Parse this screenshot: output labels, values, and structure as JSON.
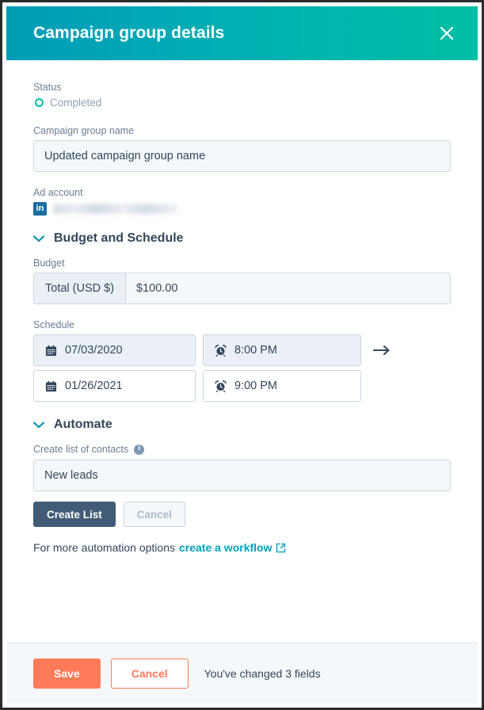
{
  "header": {
    "title": "Campaign group details",
    "close_label": "Close",
    "gradient_start": "#009cb7",
    "gradient_end": "#00bfa5"
  },
  "status": {
    "label": "Status",
    "value": "Completed",
    "indicator_color": "#00bda5"
  },
  "campaign_group_name": {
    "label": "Campaign group name",
    "value": "Updated campaign group name"
  },
  "ad_account": {
    "label": "Ad account",
    "network_icon": "linkedin-icon",
    "network_initials": "in",
    "account_name_redacted": true
  },
  "budget_schedule": {
    "section_title": "Budget and Schedule",
    "expanded": true,
    "budget": {
      "label": "Budget",
      "prefix": "Total (USD $)",
      "value": "$100.00"
    },
    "schedule": {
      "label": "Schedule",
      "rows": [
        {
          "date": "07/03/2020",
          "time": "8:00 PM",
          "highlighted": true
        },
        {
          "date": "01/26/2021",
          "time": "9:00 PM",
          "highlighted": false
        }
      ],
      "arrow": "→"
    }
  },
  "automate": {
    "section_title": "Automate",
    "expanded": true,
    "list_field": {
      "label": "Create list of contacts",
      "info_icon": "info-icon",
      "value": "New leads"
    },
    "create_list_label": "Create List",
    "cancel_label": "Cancel",
    "note_prefix": "For more automation options",
    "note_link": "create a workflow",
    "link_color": "#00a4bd"
  },
  "footer": {
    "save_label": "Save",
    "cancel_label": "Cancel",
    "status_text": "You've changed 3 fields",
    "save_color": "#ff7a59"
  }
}
